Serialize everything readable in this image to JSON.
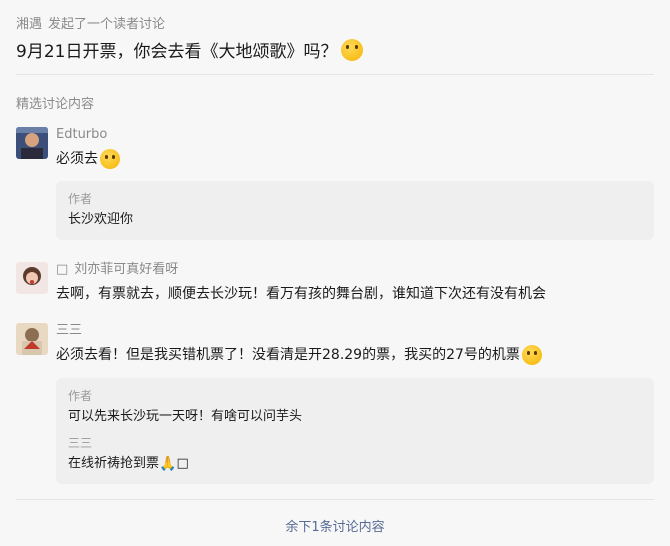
{
  "header": {
    "author": "湘遇",
    "action": "发起了一个读者讨论"
  },
  "title": {
    "text": "9月21日开票，你会去看《大地颂歌》吗？",
    "emoji": "grinning-face-emoji"
  },
  "section_label": "精选讨论内容",
  "comments": [
    {
      "name": "Edturbo",
      "text": "必须去",
      "emoji": "grinning-squint-emoji",
      "replies": [
        {
          "label": "作者",
          "text": "长沙欢迎你"
        }
      ]
    },
    {
      "name": "刘亦菲可真好看呀",
      "name_prefix_glyph": "□",
      "text": "去啊，有票就去，顺便去长沙玩！看万有孩的舞台剧，谁知道下次还有没有机会"
    },
    {
      "name": "三三",
      "text": "必须去看！但是我买错机票了！没看清是开28.29的票，我买的27号的机票",
      "emoji": "sweat-face-emoji",
      "replies": [
        {
          "label": "作者",
          "text": "可以先来长沙玩一天呀！有啥可以问芋头"
        },
        {
          "label": "三三",
          "text": "在线祈祷抢到票",
          "emoji": "pray-emoji",
          "suffix_glyph": "□"
        }
      ]
    }
  ],
  "more_link": "余下1条讨论内容",
  "colors": {
    "link": "#576b95",
    "bg": "#f7f7f7",
    "reply_bg": "#efefef"
  }
}
